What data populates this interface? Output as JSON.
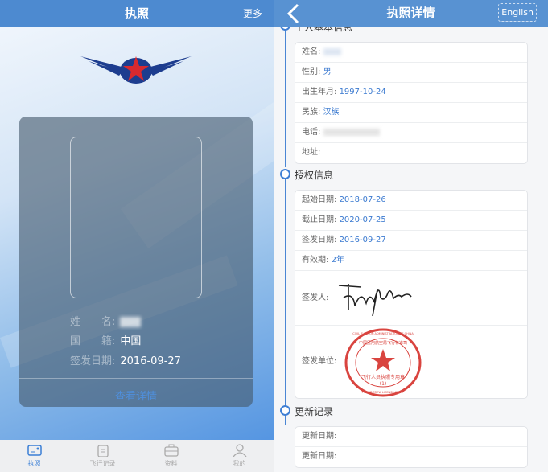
{
  "left": {
    "title": "执照",
    "more": "更多",
    "card": {
      "fields": [
        {
          "label": "姓　　名:",
          "value": ""
        },
        {
          "label": "国　　籍:",
          "value": "中国"
        },
        {
          "label": "签发日期:",
          "value": "2016-09-27"
        }
      ],
      "detail_link": "查看详情"
    },
    "tabs": [
      {
        "label": "执照",
        "icon": "license-card-icon",
        "active": true
      },
      {
        "label": "飞行记录",
        "icon": "clipboard-icon"
      },
      {
        "label": "资料",
        "icon": "briefcase-icon"
      },
      {
        "label": "我的",
        "icon": "person-icon"
      }
    ]
  },
  "right": {
    "title": "执照详情",
    "lang_button": "English",
    "sections": {
      "personal": {
        "title": "个人基本信息",
        "rows": [
          {
            "label": "姓名:",
            "value": ""
          },
          {
            "label": "性别:",
            "value": "男"
          },
          {
            "label": "出生年月:",
            "value": "1997-10-24"
          },
          {
            "label": "民族:",
            "value": "汉族"
          },
          {
            "label": "电话:",
            "value": ""
          },
          {
            "label": "地址:",
            "value": ""
          }
        ]
      },
      "auth": {
        "title": "授权信息",
        "rows": [
          {
            "label": "起始日期:",
            "value": "2018-07-26"
          },
          {
            "label": "截止日期:",
            "value": "2020-07-25"
          },
          {
            "label": "签发日期:",
            "value": "2016-09-27"
          },
          {
            "label": "有效期:",
            "value": "2年"
          }
        ],
        "signer_label": "签发人:",
        "unit_label": "签发单位:",
        "stamp": {
          "outer": "CIVIL AVIATION ADMINISTRATION OF CHINA",
          "top": "中国民用航空局飞行标准司",
          "middle": "飞行人员执照专用章",
          "number": "(1)",
          "bottom": "FLIGHT CREW LICENSE STAMP"
        }
      },
      "updates": {
        "title": "更新记录",
        "rows": [
          {
            "label": "更新日期:",
            "value": ""
          },
          {
            "label": "更新日期:",
            "value": ""
          }
        ]
      }
    }
  },
  "colors": {
    "header": "#4d8ad0",
    "accent": "#3b7ad0",
    "stamp": "#d9443f"
  }
}
